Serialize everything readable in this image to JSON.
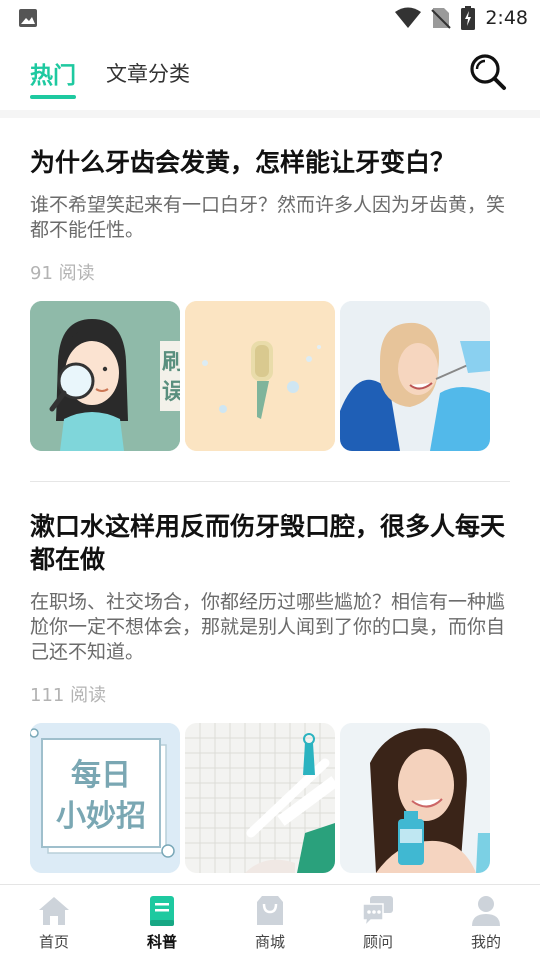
{
  "status_bar": {
    "time": "2:48",
    "icons": [
      "image-icon",
      "wifi-icon",
      "no-sim-icon",
      "battery-charging-icon"
    ]
  },
  "header": {
    "tabs": [
      {
        "label": "热门",
        "active": true
      },
      {
        "label": "文章分类",
        "active": false
      }
    ],
    "search_icon": "search-icon"
  },
  "articles": [
    {
      "title": "为什么牙齿会发黄，怎样能让牙变白？",
      "summary": "谁不希望笑起来有一口白牙？然而许多人因为牙齿黄，笑都不能任性。",
      "reads": "91 阅读",
      "thumb_texts": [
        "刷",
        "误"
      ]
    },
    {
      "title": "漱口水这样用反而伤牙毁口腔，很多人每天都在做",
      "summary": "在职场、社交场合，你都经历过哪些尴尬？相信有一种尴尬你一定不想体会，那就是别人闻到了你的口臭，而你自己还不知道。",
      "reads": "111 阅读",
      "thumb_texts": [
        "每日",
        "小妙招"
      ]
    }
  ],
  "bottom_nav": {
    "items": [
      {
        "label": "首页",
        "icon": "home-icon",
        "active": false
      },
      {
        "label": "科普",
        "icon": "book-icon",
        "active": true
      },
      {
        "label": "商城",
        "icon": "shopping-bag-icon",
        "active": false
      },
      {
        "label": "顾问",
        "icon": "chat-icon",
        "active": false
      },
      {
        "label": "我的",
        "icon": "user-icon",
        "active": false
      }
    ]
  },
  "colors": {
    "accent": "#1ec9a0",
    "nav_inactive": "#cdd3da",
    "text_secondary": "#6b6b6b",
    "text_muted": "#b3b3b3"
  }
}
